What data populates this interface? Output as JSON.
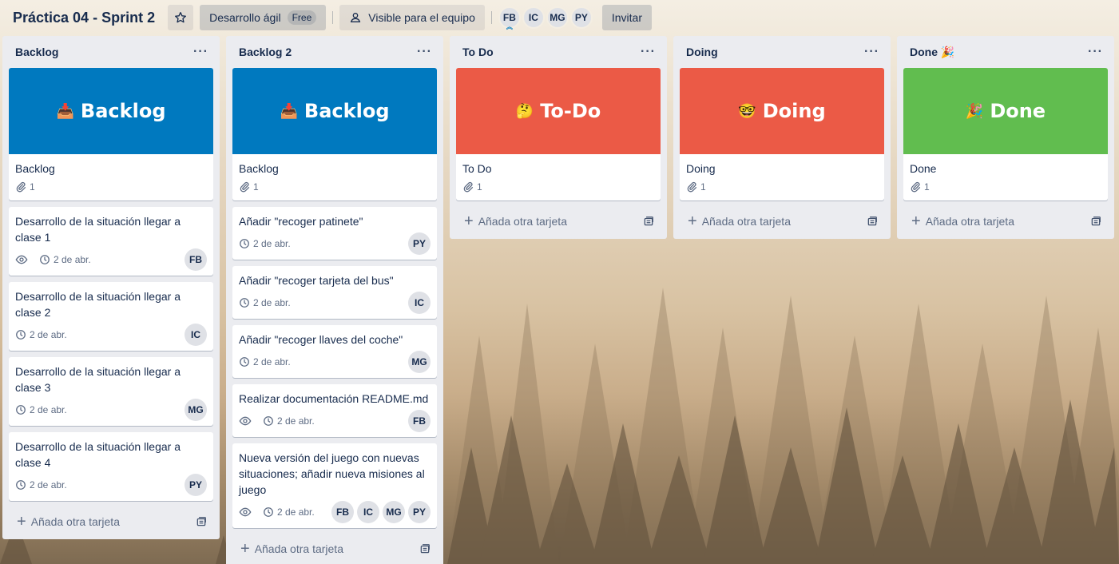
{
  "header": {
    "title": "Práctica 04 - Sprint 2",
    "workspace": "Desarrollo ágil",
    "workspace_badge": "Free",
    "visibility": "Visible para el equipo",
    "members": [
      "FB",
      "IC",
      "MG",
      "PY"
    ],
    "invite": "Invitar"
  },
  "colors": {
    "blue": "#0079bf",
    "red": "#eb5a46",
    "green": "#61bd4f"
  },
  "lists": [
    {
      "title": "Backlog",
      "menu": "···",
      "add_card": "Añada otra tarjeta",
      "cover_card": {
        "cover_emoji": "📥",
        "cover_text": "Backlog",
        "title": "Backlog",
        "attachments": "1"
      },
      "cards": [
        {
          "title": "Desarrollo de la situación llegar a clase 1",
          "watch": true,
          "due": "2 de abr.",
          "members": [
            "FB"
          ]
        },
        {
          "title": "Desarrollo de la situación llegar a clase 2",
          "watch": false,
          "due": "2 de abr.",
          "members": [
            "IC"
          ]
        },
        {
          "title": "Desarrollo de la situación llegar a clase 3",
          "watch": false,
          "due": "2 de abr.",
          "members": [
            "MG"
          ]
        },
        {
          "title": "Desarrollo de la situación llegar a clase 4",
          "watch": false,
          "due": "2 de abr.",
          "members": [
            "PY"
          ]
        }
      ]
    },
    {
      "title": "Backlog 2",
      "menu": "···",
      "add_card": "Añada otra tarjeta",
      "cover_card": {
        "cover_emoji": "📥",
        "cover_text": "Backlog",
        "title": "Backlog",
        "attachments": "1"
      },
      "cards": [
        {
          "title": "Añadir \"recoger patinete\"",
          "watch": false,
          "due": "2 de abr.",
          "members": [
            "PY"
          ]
        },
        {
          "title": "Añadir \"recoger tarjeta del bus\"",
          "watch": false,
          "due": "2 de abr.",
          "members": [
            "IC"
          ]
        },
        {
          "title": "Añadir \"recoger llaves del coche\"",
          "watch": false,
          "due": "2 de abr.",
          "members": [
            "MG"
          ]
        },
        {
          "title": "Realizar documentación README.md",
          "watch": true,
          "due": "2 de abr.",
          "members": [
            "FB"
          ]
        },
        {
          "title": "Nueva versión del juego con nuevas situaciones; añadir nueva misiones al juego",
          "watch": true,
          "due": "2 de abr.",
          "members": [
            "FB",
            "IC",
            "MG",
            "PY"
          ]
        }
      ]
    },
    {
      "title": "To Do",
      "menu": "···",
      "add_card": "Añada otra tarjeta",
      "cover_card": {
        "cover_emoji": "🤔",
        "cover_text": "To-Do",
        "title": "To Do",
        "attachments": "1"
      },
      "cards": []
    },
    {
      "title": "Doing",
      "menu": "···",
      "add_card": "Añada otra tarjeta",
      "cover_card": {
        "cover_emoji": "🤓",
        "cover_text": "Doing",
        "title": "Doing",
        "attachments": "1"
      },
      "cards": []
    },
    {
      "title": "Done 🎉",
      "menu": "···",
      "add_card": "Añada otra tarjeta",
      "cover_card": {
        "cover_emoji": "🎉",
        "cover_text": "Done",
        "title": "Done",
        "attachments": "1"
      },
      "cards": []
    }
  ]
}
